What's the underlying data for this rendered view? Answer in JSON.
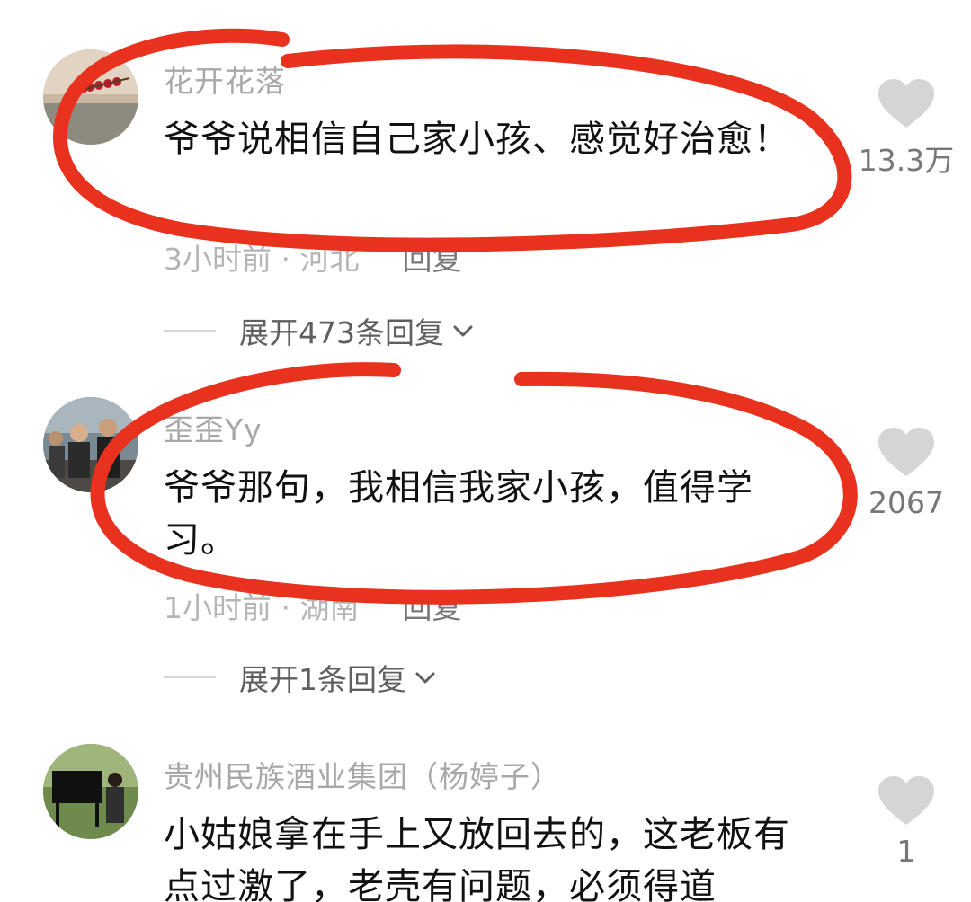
{
  "comments": [
    {
      "username": "花开花落",
      "text": "爷爷说相信自己家小孩、感觉好治愈！",
      "time": "3小时前",
      "location": "河北",
      "reply_label": "回复",
      "expand_label": "展开473条回复",
      "likes": "13.3万"
    },
    {
      "username": "歪歪Yy",
      "text": "爷爷那句，我相信我家小孩，值得学习。",
      "time": "1小时前",
      "location": "湖南",
      "reply_label": "回复",
      "expand_label": "展开1条回复",
      "likes": "2067"
    },
    {
      "username": "贵州民族酒业集团（杨婷子）",
      "text": "小姑娘拿在手上又放回去的，这老板有点过激了，老壳有问题，必须得道",
      "likes": "1"
    }
  ],
  "meta_separator": " · ",
  "colors": {
    "annotation_red": "#e8321e",
    "heart_gray": "#d5d5d5",
    "username_gray": "#a8a8a8"
  },
  "icons": [
    "avatar-image",
    "heart-icon",
    "chevron-down-icon"
  ]
}
